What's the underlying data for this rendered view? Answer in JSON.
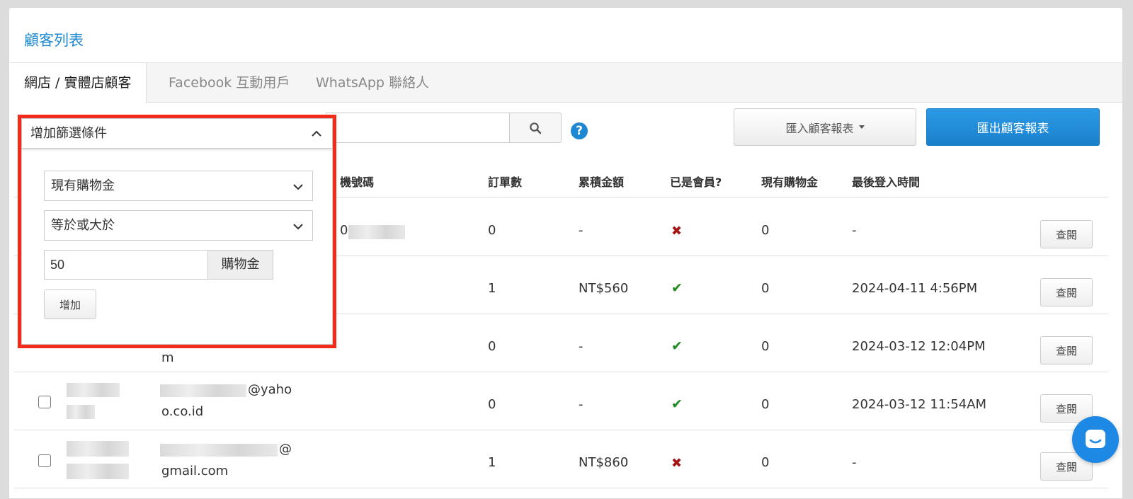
{
  "panel": {
    "title": "顧客列表"
  },
  "tabs": [
    {
      "label": "網店 / 實體店顧客",
      "active": true
    },
    {
      "label": "Facebook 互動用戶",
      "active": false
    },
    {
      "label": "WhatsApp 聯絡人",
      "active": false
    }
  ],
  "toolbar": {
    "help_label": "?",
    "import_label": "匯入顧客報表",
    "export_label": "匯出顧客報表"
  },
  "filter": {
    "header_label": "增加篩選條件",
    "field_select": "現有購物金",
    "operator_select": "等於或大於",
    "amount_value": "50",
    "amount_addon": "購物金",
    "add_label": "增加"
  },
  "table": {
    "headers": {
      "phone": "機號碼",
      "orders": "訂單數",
      "total": "累積金額",
      "member": "已是會員?",
      "credit": "現有購物金",
      "last_login": "最後登入時間"
    },
    "rows": [
      {
        "phone": "0",
        "email": "",
        "orders": "0",
        "total": "-",
        "member": false,
        "credit": "0",
        "last_login": "-",
        "view": "查閱"
      },
      {
        "phone": "",
        "email": "",
        "orders": "1",
        "total": "NT$560",
        "member": true,
        "credit": "0",
        "last_login": "2024-04-11 4:56PM",
        "view": "查閱"
      },
      {
        "phone": "",
        "email": "m",
        "orders": "0",
        "total": "-",
        "member": true,
        "credit": "0",
        "last_login": "2024-03-12 12:04PM",
        "view": "查閱"
      },
      {
        "phone": "",
        "email": "@yaho",
        "email2": "o.co.id",
        "orders": "0",
        "total": "-",
        "member": true,
        "credit": "0",
        "last_login": "2024-03-12 11:54AM",
        "view": "查閱"
      },
      {
        "phone": "",
        "email": "@",
        "email2": "gmail.com",
        "orders": "1",
        "total": "NT$860",
        "member": false,
        "credit": "0",
        "last_login": "-",
        "view": "查閱"
      }
    ]
  },
  "colors": {
    "accent": "#1e88d2",
    "highlight": "#f22b1b",
    "check": "#1f8a1f",
    "cross": "#a31515"
  }
}
